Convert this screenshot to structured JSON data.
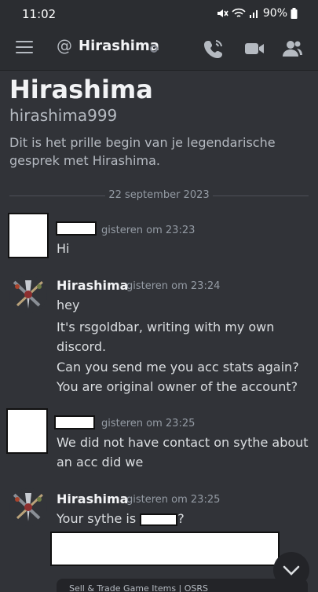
{
  "status_bar": {
    "time": "11:02",
    "battery": "90%"
  },
  "header": {
    "title": "Hirashima"
  },
  "intro": {
    "name": "Hirashima",
    "username": "hirashima999",
    "text": "Dit is het prille begin van je legendarische gesprek met Hirashima."
  },
  "date_divider": "22 september 2023",
  "messages": [
    {
      "author": "",
      "time": "gisteren om 23:23",
      "lines": [
        "Hi"
      ]
    },
    {
      "author": "Hirashima",
      "time": "gisteren om 23:24",
      "lines": [
        "hey",
        "It's rsgoldbar, writing with my own",
        "discord.",
        "Can you send me you acc stats again?",
        "You are original owner of the account?"
      ]
    },
    {
      "author": "",
      "time": "gisteren om 23:25",
      "lines": [
        "We did not have contact on sythe about",
        "an acc did we"
      ]
    },
    {
      "author": "Hirashima",
      "time": "gisteren om 23:25",
      "text_before": "Your sythe is ",
      "text_after": "?"
    }
  ],
  "bottom_chip": "Sell & Trade Game Items | OSRS",
  "colors": {
    "background": "#313338",
    "header": "#2b2d31",
    "text": "#dbdee1",
    "muted": "#949ba4"
  },
  "icons": [
    "menu-icon",
    "at-icon",
    "call-icon",
    "video-icon",
    "members-icon",
    "mute-icon",
    "wifi-icon",
    "signal-icon",
    "battery-icon",
    "chevron-down-icon"
  ]
}
